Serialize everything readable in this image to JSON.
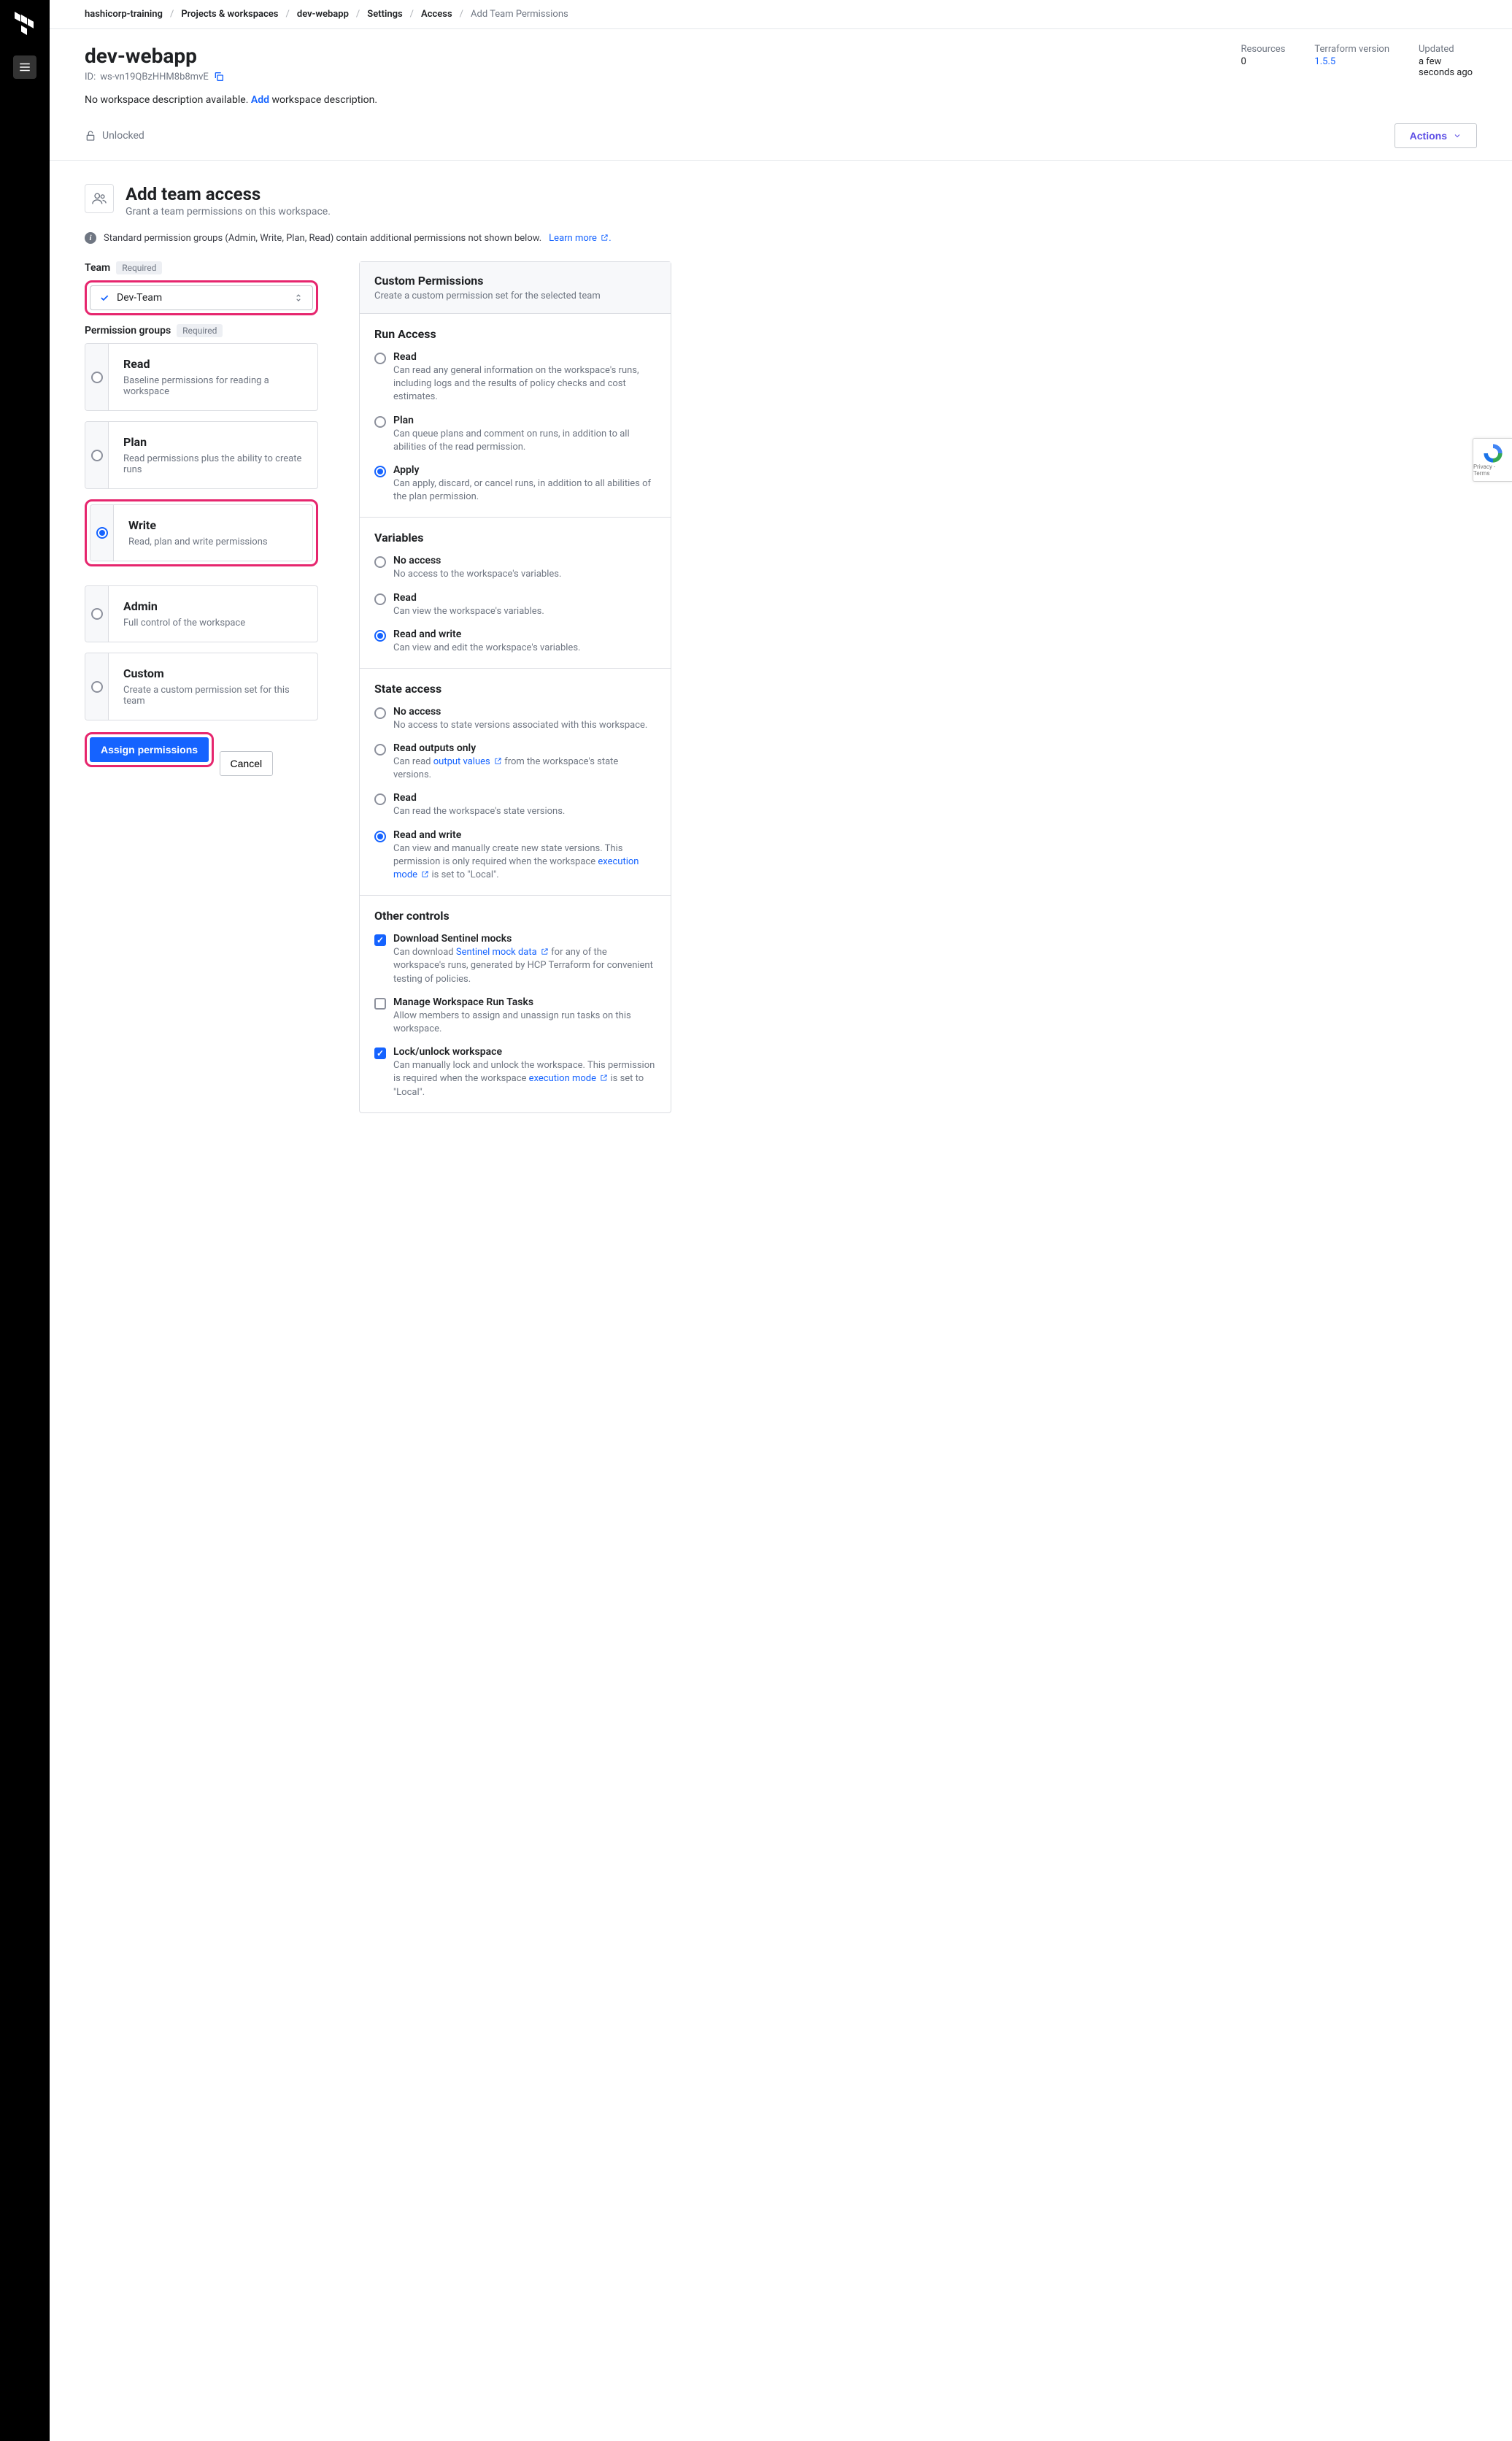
{
  "breadcrumbs": {
    "org": "hashicorp-training",
    "projects": "Projects & workspaces",
    "workspace": "dev-webapp",
    "settings": "Settings",
    "access": "Access",
    "current": "Add Team Permissions"
  },
  "workspace": {
    "name": "dev-webapp",
    "id_prefix": "ID:",
    "id": "ws-vn19QBzHHM8b8mvE",
    "desc_none": "No workspace description available.",
    "desc_add": "Add",
    "desc_suffix": "workspace description.",
    "unlocked": "Unlocked"
  },
  "meta": {
    "resources_label": "Resources",
    "resources_val": "0",
    "tf_label": "Terraform version",
    "tf_val": "1.5.5",
    "updated_label": "Updated",
    "updated_val": "a few seconds ago"
  },
  "actions_btn": "Actions",
  "page": {
    "title": "Add team access",
    "subtitle": "Grant a team permissions on this workspace.",
    "note": "Standard permission groups (Admin, Write, Plan, Read) contain additional permissions not shown below.",
    "learn_more": "Learn more"
  },
  "team_field": {
    "label": "Team",
    "required": "Required",
    "selected": "Dev-Team"
  },
  "perm_field": {
    "label": "Permission groups",
    "required": "Required"
  },
  "perm_groups": [
    {
      "key": "read",
      "title": "Read",
      "desc": "Baseline permissions for reading a workspace",
      "selected": false,
      "highlight": false
    },
    {
      "key": "plan",
      "title": "Plan",
      "desc": "Read permissions plus the ability to create runs",
      "selected": false,
      "highlight": false
    },
    {
      "key": "write",
      "title": "Write",
      "desc": "Read, plan and write permissions",
      "selected": true,
      "highlight": true
    },
    {
      "key": "admin",
      "title": "Admin",
      "desc": "Full control of the workspace",
      "selected": false,
      "highlight": false
    },
    {
      "key": "custom",
      "title": "Custom",
      "desc": "Create a custom permission set for this team",
      "selected": false,
      "highlight": false
    }
  ],
  "buttons": {
    "assign": "Assign permissions",
    "cancel": "Cancel"
  },
  "custom": {
    "title": "Custom Permissions",
    "subtitle": "Create a custom permission set for the selected team"
  },
  "run_access": {
    "title": "Run Access",
    "opts": [
      {
        "label": "Read",
        "desc": "Can read any general information on the workspace's runs, including logs and the results of policy checks and cost estimates.",
        "selected": false
      },
      {
        "label": "Plan",
        "desc": "Can queue plans and comment on runs, in addition to all abilities of the read permission.",
        "selected": false
      },
      {
        "label": "Apply",
        "desc": "Can apply, discard, or cancel runs, in addition to all abilities of the plan permission.",
        "selected": true
      }
    ]
  },
  "variables": {
    "title": "Variables",
    "opts": [
      {
        "label": "No access",
        "desc": "No access to the workspace's variables.",
        "selected": false
      },
      {
        "label": "Read",
        "desc": "Can view the workspace's variables.",
        "selected": false
      },
      {
        "label": "Read and write",
        "desc": "Can view and edit the workspace's variables.",
        "selected": true
      }
    ]
  },
  "state": {
    "title": "State access",
    "opts": [
      {
        "label": "No access",
        "desc_pre": "No access to state versions associated with this workspace.",
        "selected": false
      },
      {
        "label": "Read outputs only",
        "desc_pre": "Can read ",
        "link": "output values",
        "desc_post": " from the workspace's state versions.",
        "selected": false
      },
      {
        "label": "Read",
        "desc_pre": "Can read the workspace's state versions.",
        "selected": false
      },
      {
        "label": "Read and write",
        "desc_pre": "Can view and manually create new state versions. This permission is only required when the workspace ",
        "link": "execution mode",
        "desc_post": " is set to \"Local\".",
        "selected": true
      }
    ]
  },
  "other": {
    "title": "Other controls",
    "opts": [
      {
        "label": "Download Sentinel mocks",
        "desc_pre": "Can download ",
        "link": "Sentinel mock data",
        "desc_post": " for any of the workspace's runs, generated by HCP Terraform for convenient testing of policies.",
        "checked": true
      },
      {
        "label": "Manage Workspace Run Tasks",
        "desc_pre": "Allow members to assign and unassign run tasks on this workspace.",
        "checked": false
      },
      {
        "label": "Lock/unlock workspace",
        "desc_pre": "Can manually lock and unlock the workspace. This permission is required when the workspace ",
        "link": "execution mode",
        "desc_post": " is set to \"Local\".",
        "checked": true
      }
    ]
  },
  "recaptcha": "Privacy - Terms"
}
